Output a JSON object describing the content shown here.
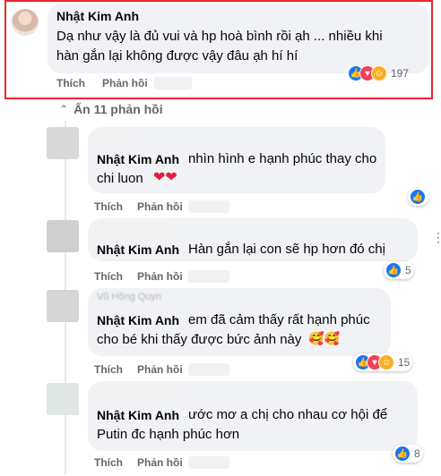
{
  "main_comment": {
    "author": "Nhật Kim Anh",
    "text_line1": "Dạ như vậy là đủ vui và hp hoà bình rồi ạh ... nhiều khi",
    "text_line2": "hàn gắn lại không được vậy đâu ạh hí hí",
    "like_label": "Thích",
    "reply_label": "Phản hồi",
    "reaction_count": "197"
  },
  "hide_replies_label": "Ẩn 11 phản hồi",
  "replies": [
    {
      "author": "Nhật Kim Anh",
      "line1": "nhìn hình e hạnh phúc thay cho",
      "line2": "chi luon",
      "like_label": "Thích",
      "reply_label": "Phản hồi",
      "reaction_count": ""
    },
    {
      "author": "Nhật Kim Anh",
      "line1": "Hàn gắn lại con sẽ hp hơn đó chị",
      "like_label": "Thích",
      "reply_label": "Phản hồi",
      "reaction_count": "5"
    },
    {
      "mention": "Vũ Hồng Quyn",
      "author": "Nhật Kim Anh",
      "line1": "em đã cảm thấy rất hạnh phúc",
      "line2": "cho bé khi thấy được bức ảnh này",
      "like_label": "Thích",
      "reply_label": "Phản hồi",
      "reaction_count": "15"
    },
    {
      "author": "Nhật Kim Anh",
      "line1": "ước mơ a chị cho nhau cơ hội để",
      "line2": "Putin đc hạnh phúc hơn",
      "like_label": "Thích",
      "reply_label": "Phản hồi",
      "reaction_count": "8"
    }
  ],
  "icons": {
    "like": "like-icon",
    "love": "love-icon",
    "care": "care-icon",
    "more": "more-options-icon",
    "chevron": "chevron-up-icon"
  },
  "colors": {
    "highlight_border": "#e8262e",
    "like_blue": "#1877f2",
    "love_red": "#f33e58",
    "care_yellow": "#f7b125",
    "bubble_bg": "#f0f2f5"
  }
}
